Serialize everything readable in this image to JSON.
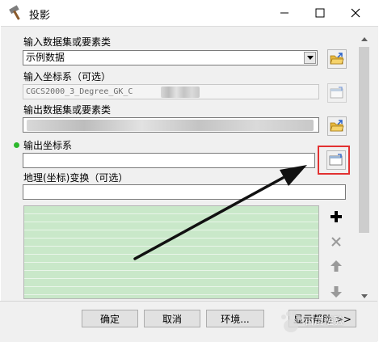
{
  "window": {
    "title": "投影",
    "app_icon": "hammer-icon",
    "minimize_icon": "minimize-icon",
    "maximize_icon": "maximize-icon",
    "close_icon": "close-icon"
  },
  "form": {
    "input_dataset": {
      "label": "输入数据集或要素类",
      "value": "示例数据"
    },
    "input_crs": {
      "label": "输入坐标系（可选）",
      "value": "CGCS2000_3_Degree_GK_C"
    },
    "output_dataset": {
      "label": "输出数据集或要素类",
      "value": ""
    },
    "output_crs": {
      "label": "输出坐标系",
      "value": ""
    },
    "geo_transform": {
      "label": "地理(坐标)变换（可选）",
      "value": ""
    }
  },
  "side_tools": {
    "add_icon": "plus-icon",
    "remove_icon": "x-icon",
    "up_icon": "arrow-up-icon",
    "down_icon": "arrow-down-icon"
  },
  "footer": {
    "ok_label": "确定",
    "cancel_label": "取消",
    "env_label": "环境...",
    "help_label": "显示帮助 >>"
  },
  "watermark": {
    "text": "百度经验",
    "logo": "baidu-logo"
  },
  "colors": {
    "highlight": "#e23131",
    "required_dot": "#2db82d",
    "list_bg": "#c9e8c9"
  }
}
